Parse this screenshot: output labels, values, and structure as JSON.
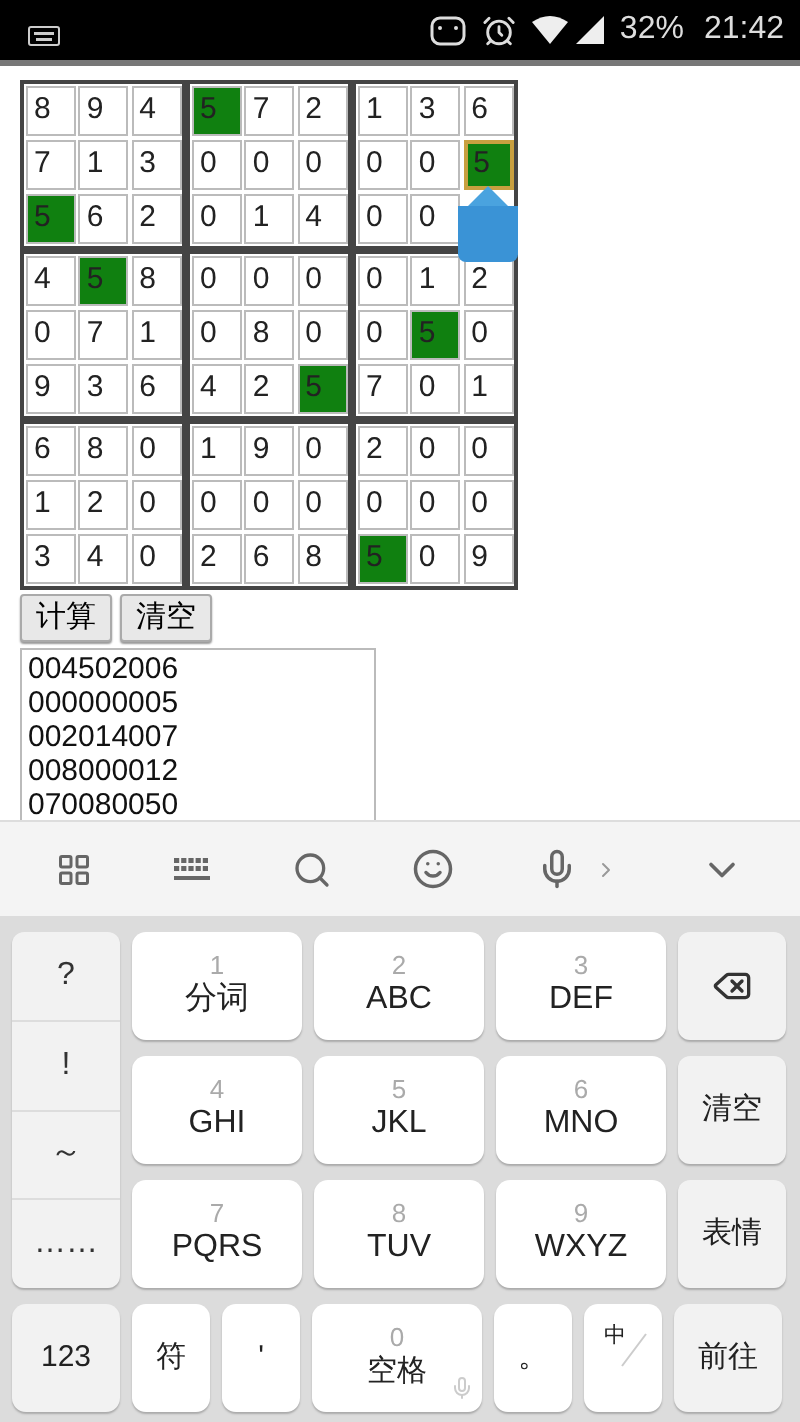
{
  "status_bar": {
    "battery": "32%",
    "time": "21:42"
  },
  "grid": {
    "rows": [
      {
        "cells": [
          {
            "value": "8",
            "highlighted": false
          },
          {
            "value": "9",
            "highlighted": false
          },
          {
            "value": "4",
            "highlighted": false
          },
          {
            "value": "5",
            "highlighted": true
          },
          {
            "value": "7",
            "highlighted": false
          },
          {
            "value": "2",
            "highlighted": false
          },
          {
            "value": "1",
            "highlighted": false
          },
          {
            "value": "3",
            "highlighted": false
          },
          {
            "value": "6",
            "highlighted": false
          }
        ]
      },
      {
        "cells": [
          {
            "value": "7",
            "highlighted": false
          },
          {
            "value": "1",
            "highlighted": false
          },
          {
            "value": "3",
            "highlighted": false
          },
          {
            "value": "0",
            "highlighted": false
          },
          {
            "value": "0",
            "highlighted": false
          },
          {
            "value": "0",
            "highlighted": false
          },
          {
            "value": "0",
            "highlighted": false
          },
          {
            "value": "0",
            "highlighted": false
          },
          {
            "value": "5",
            "highlighted": true,
            "focused": true
          }
        ]
      },
      {
        "cells": [
          {
            "value": "5",
            "highlighted": true
          },
          {
            "value": "6",
            "highlighted": false
          },
          {
            "value": "2",
            "highlighted": false
          },
          {
            "value": "0",
            "highlighted": false
          },
          {
            "value": "1",
            "highlighted": false
          },
          {
            "value": "4",
            "highlighted": false
          },
          {
            "value": "0",
            "highlighted": false
          },
          {
            "value": "0",
            "highlighted": false
          },
          {
            "covered": true
          }
        ]
      },
      {
        "cells": [
          {
            "value": "4",
            "highlighted": false
          },
          {
            "value": "5",
            "highlighted": true
          },
          {
            "value": "8",
            "highlighted": false
          },
          {
            "value": "0",
            "highlighted": false
          },
          {
            "value": "0",
            "highlighted": false
          },
          {
            "value": "0",
            "highlighted": false
          },
          {
            "value": "0",
            "highlighted": false
          },
          {
            "value": "1",
            "highlighted": false
          },
          {
            "value": "2",
            "highlighted": false
          }
        ]
      },
      {
        "cells": [
          {
            "value": "0",
            "highlighted": false
          },
          {
            "value": "7",
            "highlighted": false
          },
          {
            "value": "1",
            "highlighted": false
          },
          {
            "value": "0",
            "highlighted": false
          },
          {
            "value": "8",
            "highlighted": false
          },
          {
            "value": "0",
            "highlighted": false
          },
          {
            "value": "0",
            "highlighted": false
          },
          {
            "value": "5",
            "highlighted": true
          },
          {
            "value": "0",
            "highlighted": false
          }
        ]
      },
      {
        "cells": [
          {
            "value": "9",
            "highlighted": false
          },
          {
            "value": "3",
            "highlighted": false
          },
          {
            "value": "6",
            "highlighted": false
          },
          {
            "value": "4",
            "highlighted": false
          },
          {
            "value": "2",
            "highlighted": false
          },
          {
            "value": "5",
            "highlighted": true
          },
          {
            "value": "7",
            "highlighted": false
          },
          {
            "value": "0",
            "highlighted": false
          },
          {
            "value": "1",
            "highlighted": false
          }
        ]
      },
      {
        "cells": [
          {
            "value": "6",
            "highlighted": false
          },
          {
            "value": "8",
            "highlighted": false
          },
          {
            "value": "0",
            "highlighted": false
          },
          {
            "value": "1",
            "highlighted": false
          },
          {
            "value": "9",
            "highlighted": false
          },
          {
            "value": "0",
            "highlighted": false
          },
          {
            "value": "2",
            "highlighted": false
          },
          {
            "value": "0",
            "highlighted": false
          },
          {
            "value": "0",
            "highlighted": false
          }
        ]
      },
      {
        "cells": [
          {
            "value": "1",
            "highlighted": false
          },
          {
            "value": "2",
            "highlighted": false
          },
          {
            "value": "0",
            "highlighted": false
          },
          {
            "value": "0",
            "highlighted": false
          },
          {
            "value": "0",
            "highlighted": false
          },
          {
            "value": "0",
            "highlighted": false
          },
          {
            "value": "0",
            "highlighted": false
          },
          {
            "value": "0",
            "highlighted": false
          },
          {
            "value": "0",
            "highlighted": false
          }
        ]
      },
      {
        "cells": [
          {
            "value": "3",
            "highlighted": false
          },
          {
            "value": "4",
            "highlighted": false
          },
          {
            "value": "0",
            "highlighted": false
          },
          {
            "value": "2",
            "highlighted": false
          },
          {
            "value": "6",
            "highlighted": false
          },
          {
            "value": "8",
            "highlighted": false
          },
          {
            "value": "5",
            "highlighted": true
          },
          {
            "value": "0",
            "highlighted": false
          },
          {
            "value": "9",
            "highlighted": false
          }
        ]
      }
    ]
  },
  "buttons": [
    "计算",
    "清空"
  ],
  "textarea": {
    "lines": [
      "004502006",
      "000000005",
      "002014007",
      "008000012",
      "070080050"
    ]
  },
  "keyboard": {
    "side_keys": [
      "?",
      "!",
      "～",
      "……"
    ],
    "keys": [
      {
        "digit": "1",
        "label": "分词"
      },
      {
        "digit": "2",
        "label": "ABC"
      },
      {
        "digit": "3",
        "label": "DEF"
      },
      {
        "digit": "4",
        "label": "GHI"
      },
      {
        "digit": "5",
        "label": "JKL"
      },
      {
        "digit": "6",
        "label": "MNO"
      },
      {
        "digit": "7",
        "label": "PQRS"
      },
      {
        "digit": "8",
        "label": "TUV"
      },
      {
        "digit": "9",
        "label": "WXYZ"
      }
    ],
    "right_keys": [
      "清空",
      "表情"
    ],
    "bottom_row": [
      {
        "kind": "text",
        "label": "123"
      },
      {
        "kind": "text",
        "label": "符"
      },
      {
        "kind": "text",
        "label": "'"
      },
      {
        "kind": "space",
        "digit": "0",
        "label": "空格"
      },
      {
        "kind": "text",
        "label": "。"
      },
      {
        "kind": "switch",
        "label": "中"
      },
      {
        "kind": "text",
        "label": "前往"
      }
    ]
  }
}
